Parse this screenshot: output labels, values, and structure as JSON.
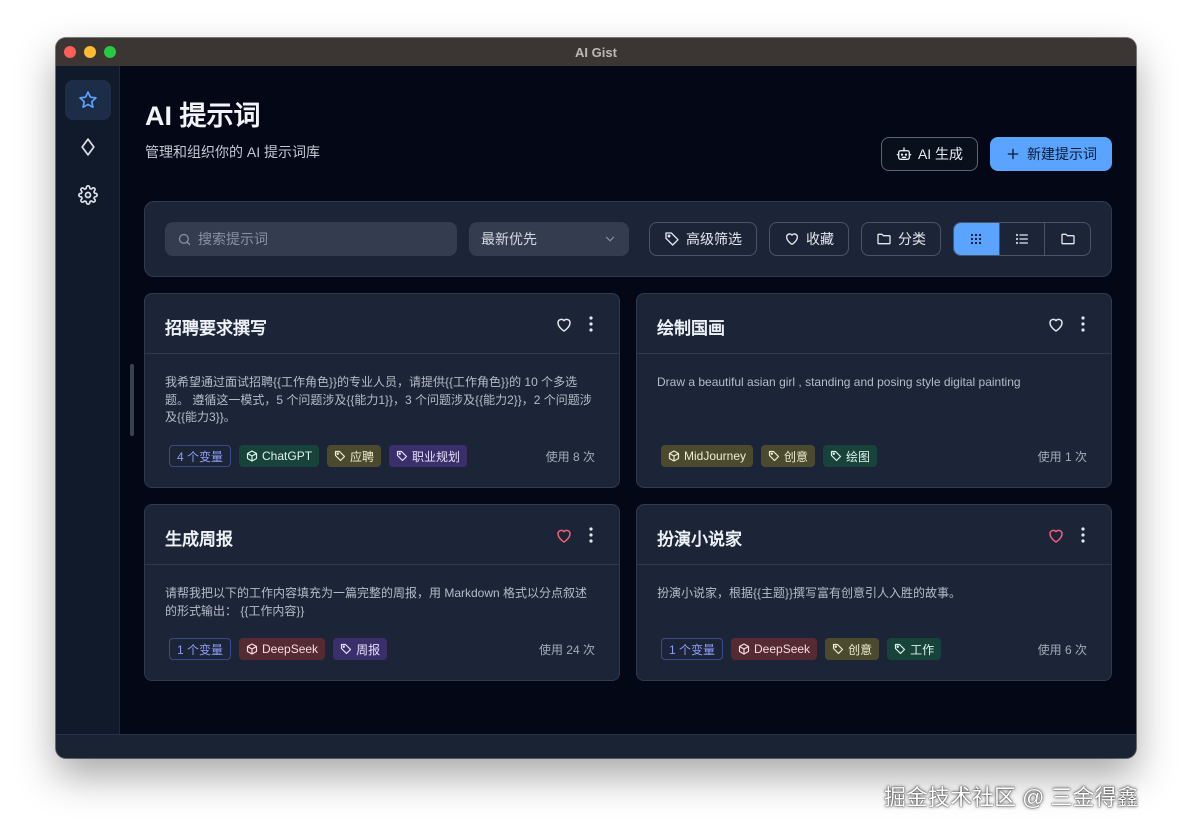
{
  "window": {
    "title": "AI Gist"
  },
  "sidebar": {
    "items": [
      {
        "icon": "star-icon",
        "active": true
      },
      {
        "icon": "diamond-icon",
        "active": false
      },
      {
        "icon": "gear-icon",
        "active": false
      }
    ]
  },
  "header": {
    "title": "AI 提示词",
    "subtitle": "管理和组织你的 AI 提示词库",
    "ai_button": "AI 生成",
    "new_button": "新建提示词"
  },
  "toolbar": {
    "search_placeholder": "搜索提示词",
    "sort_value": "最新优先",
    "advanced_filter": "高级筛选",
    "favorites": "收藏",
    "categories": "分类",
    "view_modes": [
      "grid",
      "list",
      "folder"
    ],
    "active_view": "grid"
  },
  "prompts": [
    {
      "title": "招聘要求撰写",
      "favorited": false,
      "body": "我希望通过面试招聘{{工作角色}}的专业人员，请提供{{工作角色}}的 10 个多选题。 遵循这一模式，5 个问题涉及{{能力1}}，3 个问题涉及{{能力2}}，2 个问题涉及{{能力3}}。",
      "variables": "4 个变量",
      "model": "ChatGPT",
      "tags": [
        "应聘",
        "职业规划"
      ],
      "usage": "使用 8 次"
    },
    {
      "title": "绘制国画",
      "favorited": false,
      "body": "Draw a beautiful asian girl , standing and posing style digital painting",
      "variables": "",
      "model": "MidJourney",
      "tags": [
        "创意",
        "绘图"
      ],
      "usage": "使用 1 次"
    },
    {
      "title": "生成周报",
      "favorited": true,
      "body": "请帮我把以下的工作内容填充为一篇完整的周报，用 Markdown 格式以分点叙述的形式输出： {{工作内容}}",
      "variables": "1 个变量",
      "model": "DeepSeek",
      "tags": [
        "周报"
      ],
      "usage": "使用 24 次"
    },
    {
      "title": "扮演小说家",
      "favorited": true,
      "body": "扮演小说家，根据{{主题}}撰写富有创意引人入胜的故事。",
      "variables": "1 个变量",
      "model": "DeepSeek",
      "tags": [
        "创意",
        "工作"
      ],
      "usage": "使用 6 次"
    }
  ],
  "colors": {
    "accent": "#5aa4ff",
    "background": "#040816",
    "card": "#1c2537",
    "heart_favorited": "#f0607a"
  },
  "watermark": "掘金技术社区 @ 三金得鑫"
}
